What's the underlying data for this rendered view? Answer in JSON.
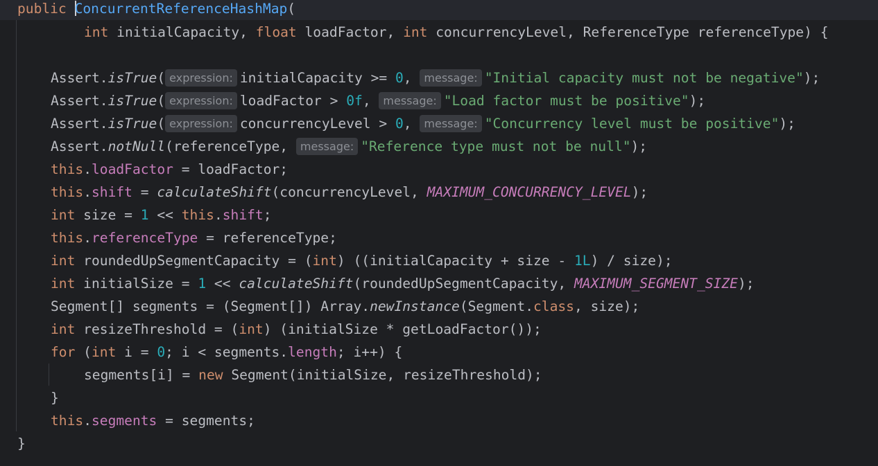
{
  "code": {
    "l1": {
      "kw_public": "public",
      "name": "ConcurrentReferenceHashMap",
      "paren": "("
    },
    "l2": {
      "int1": "int",
      "p1": " initialCapacity, ",
      "float": "float",
      "p2": " loadFactor, ",
      "int2": "int",
      "p3": " concurrencyLevel, ReferenceType referenceType) {"
    },
    "l4": {
      "pre": "Assert.",
      "fn": "isTrue",
      "open": "(",
      "hint1": "expression:",
      "p1": "initialCapacity >= ",
      "num": "0",
      "p2": ", ",
      "hint2": "message:",
      "str": "\"Initial capacity must not be negative\"",
      "end": ");"
    },
    "l5": {
      "pre": "Assert.",
      "fn": "isTrue",
      "open": "(",
      "hint1": "expression:",
      "p1": "loadFactor > ",
      "num": "0f",
      "p2": ", ",
      "hint2": "message:",
      "str": "\"Load factor must be positive\"",
      "end": ");"
    },
    "l6": {
      "pre": "Assert.",
      "fn": "isTrue",
      "open": "(",
      "hint1": "expression:",
      "p1": "concurrencyLevel > ",
      "num": "0",
      "p2": ", ",
      "hint2": "message:",
      "str": "\"Concurrency level must be positive\"",
      "end": ");"
    },
    "l7": {
      "pre": "Assert.",
      "fn": "notNull",
      "p1": "(referenceType, ",
      "hint": "message:",
      "str": "\"Reference type must not be null\"",
      "end": ");"
    },
    "l8": {
      "this": "this",
      "dot": ".",
      "field": "loadFactor",
      "rest": " = loadFactor;"
    },
    "l9": {
      "this": "this",
      "dot": ".",
      "field": "shift",
      "eq": " = ",
      "fn": "calculateShift",
      "mid": "(concurrencyLevel, ",
      "cst": "MAXIMUM_CONCURRENCY_LEVEL",
      "end": ");"
    },
    "l10": {
      "int": "int",
      "p1": " size = ",
      "num": "1",
      "p2": " << ",
      "this": "this",
      "dot": ".",
      "field": "shift",
      "end": ";"
    },
    "l11": {
      "this": "this",
      "dot": ".",
      "field": "referenceType",
      "rest": " = referenceType;"
    },
    "l12": {
      "int1": "int",
      "p1": " roundedUpSegmentCapacity = (",
      "int2": "int",
      "p2": ") ((initialCapacity + size - ",
      "num": "1L",
      "end": ") / size);"
    },
    "l13": {
      "int": "int",
      "p1": " initialSize = ",
      "num": "1",
      "p2": " << ",
      "fn": "calculateShift",
      "mid": "(roundedUpSegmentCapacity, ",
      "cst": "MAXIMUM_SEGMENT_SIZE",
      "end": ");"
    },
    "l14": {
      "p1": "Segment[] segments = (Segment[]) Array.",
      "fn": "newInstance",
      "mid": "(Segment.",
      "kw": "class",
      "end": ", size);"
    },
    "l15": {
      "int1": "int",
      "p1": " resizeThreshold = (",
      "int2": "int",
      "end": ") (initialSize * getLoadFactor());"
    },
    "l16": {
      "for": "for",
      "p1": " (",
      "int": "int",
      "p2": " i = ",
      "num": "0",
      "p3": "; i < segments.",
      "field": "length",
      "end": "; i++) {"
    },
    "l17": {
      "p1": "segments[i] = ",
      "new": "new",
      "end": " Segment(initialSize, resizeThreshold);"
    },
    "l18": {
      "brace": "}"
    },
    "l19": {
      "this": "this",
      "dot": ".",
      "field": "segments",
      "rest": " = segments;"
    },
    "l20": {
      "brace": "}"
    }
  }
}
